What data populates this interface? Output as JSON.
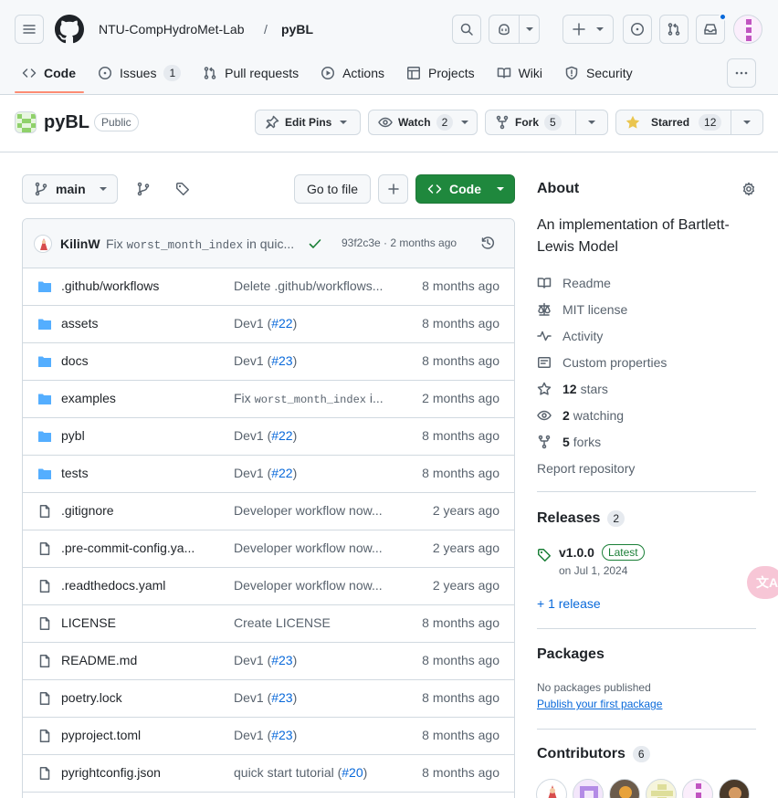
{
  "header": {
    "owner": "NTU-CompHydroMet-Lab",
    "separator": "/",
    "repo": "pyBL",
    "icons": [
      "hamburger-icon",
      "github-logo",
      "search-icon",
      "copilot-icon",
      "plus-icon",
      "issue-opened-icon",
      "pull-request-icon",
      "inbox-icon",
      "kebab-icon"
    ]
  },
  "tabs": [
    {
      "label": "Code",
      "icon": "code-icon",
      "active": true
    },
    {
      "label": "Issues",
      "icon": "issue-opened-icon",
      "count": "1"
    },
    {
      "label": "Pull requests",
      "icon": "pull-request-icon"
    },
    {
      "label": "Actions",
      "icon": "play-icon"
    },
    {
      "label": "Projects",
      "icon": "table-icon"
    },
    {
      "label": "Wiki",
      "icon": "book-icon"
    },
    {
      "label": "Security",
      "icon": "shield-icon"
    }
  ],
  "repo_bar": {
    "name": "pyBL",
    "visibility": "Public",
    "edit_pins": "Edit Pins",
    "watch": "Watch",
    "watch_count": "2",
    "fork": "Fork",
    "fork_count": "5",
    "starred": "Starred",
    "star_count": "12"
  },
  "toolbar": {
    "branch": "main",
    "go_to_file": "Go to file",
    "code": "Code"
  },
  "commit": {
    "author": "KilinW",
    "message_prefix": "Fix",
    "message_code": "worst_month_index",
    "message_suffix": "in quic...",
    "sha_time": "93f2c3e · 2 months ago",
    "status": "check-icon"
  },
  "files": [
    {
      "type": "dir",
      "name": ".github/workflows",
      "msg": "Delete .github/workflows...",
      "date": "8 months ago"
    },
    {
      "type": "dir",
      "name": "assets",
      "msg": "Dev1 (",
      "pr": "#22",
      "msg_end": ")",
      "date": "8 months ago"
    },
    {
      "type": "dir",
      "name": "docs",
      "msg": "Dev1 (",
      "pr": "#23",
      "msg_end": ")",
      "date": "8 months ago"
    },
    {
      "type": "dir",
      "name": "examples",
      "msg": "Fix ",
      "code": "worst_month_index",
      "msg_end": " i...",
      "date": "2 months ago"
    },
    {
      "type": "dir",
      "name": "pybl",
      "msg": "Dev1 (",
      "pr": "#22",
      "msg_end": ")",
      "date": "8 months ago"
    },
    {
      "type": "dir",
      "name": "tests",
      "msg": "Dev1 (",
      "pr": "#22",
      "msg_end": ")",
      "date": "8 months ago"
    },
    {
      "type": "file",
      "name": ".gitignore",
      "msg": "Developer workflow now...",
      "date": "2 years ago"
    },
    {
      "type": "file",
      "name": ".pre-commit-config.ya...",
      "msg": "Developer workflow now...",
      "date": "2 years ago"
    },
    {
      "type": "file",
      "name": ".readthedocs.yaml",
      "msg": "Developer workflow now...",
      "date": "2 years ago"
    },
    {
      "type": "file",
      "name": "LICENSE",
      "msg": "Create LICENSE",
      "date": "8 months ago"
    },
    {
      "type": "file",
      "name": "README.md",
      "msg": "Dev1 (",
      "pr": "#23",
      "msg_end": ")",
      "date": "8 months ago"
    },
    {
      "type": "file",
      "name": "poetry.lock",
      "msg": "Dev1 (",
      "pr": "#23",
      "msg_end": ")",
      "date": "8 months ago"
    },
    {
      "type": "file",
      "name": "pyproject.toml",
      "msg": "Dev1 (",
      "pr": "#23",
      "msg_end": ")",
      "date": "8 months ago"
    },
    {
      "type": "file",
      "name": "pyrightconfig.json",
      "msg": "quick start tutorial (",
      "pr": "#20",
      "msg_end": ")",
      "date": "8 months ago"
    }
  ],
  "about": {
    "title": "About",
    "description": "An implementation of Bartlett-Lewis Model",
    "readme": "Readme",
    "license": "MIT license",
    "activity": "Activity",
    "custom_properties": "Custom properties",
    "stars_count": "12",
    "stars_label": "stars",
    "watching_count": "2",
    "watching_label": "watching",
    "forks_count": "5",
    "forks_label": "forks",
    "report": "Report repository"
  },
  "releases": {
    "title": "Releases",
    "count": "2",
    "version": "v1.0.0",
    "latest": "Latest",
    "date": "on Jul 1, 2024",
    "more": "+ 1 release"
  },
  "packages": {
    "title": "Packages",
    "none": "No packages published",
    "publish": "Publish your first package"
  },
  "contributors": {
    "title": "Contributors",
    "count": "6"
  },
  "floating": {
    "translate": "文A"
  },
  "colors": {
    "accent": "#0969da",
    "green": "#1f883d",
    "tab_underline": "#fd8c73",
    "star": "#eac54f"
  }
}
